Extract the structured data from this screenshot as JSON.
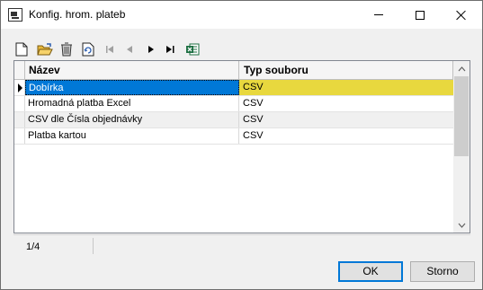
{
  "window": {
    "title": "Konfig. hrom. plateb"
  },
  "toolbar": {
    "buttons": [
      "new-document-icon",
      "open-folder-icon",
      "delete-icon",
      "refresh-icon",
      "first-record-icon",
      "previous-record-icon",
      "next-record-icon",
      "last-record-icon",
      "excel-export-icon"
    ]
  },
  "grid": {
    "columns": [
      "Název",
      "Typ souboru"
    ],
    "rows": [
      {
        "name": "Dobírka",
        "type": "CSV"
      },
      {
        "name": "Hromadná platba Excel",
        "type": "CSV"
      },
      {
        "name": "CSV dle Čísla objednávky",
        "type": "CSV"
      },
      {
        "name": "Platba kartou",
        "type": "CSV"
      }
    ],
    "selected_row": 0
  },
  "status": {
    "record_count": "1/4"
  },
  "buttons": {
    "ok": "OK",
    "cancel": "Storno"
  },
  "colors": {
    "selection": "#0078d7",
    "selected_cell_highlight": "#e8d83e"
  }
}
